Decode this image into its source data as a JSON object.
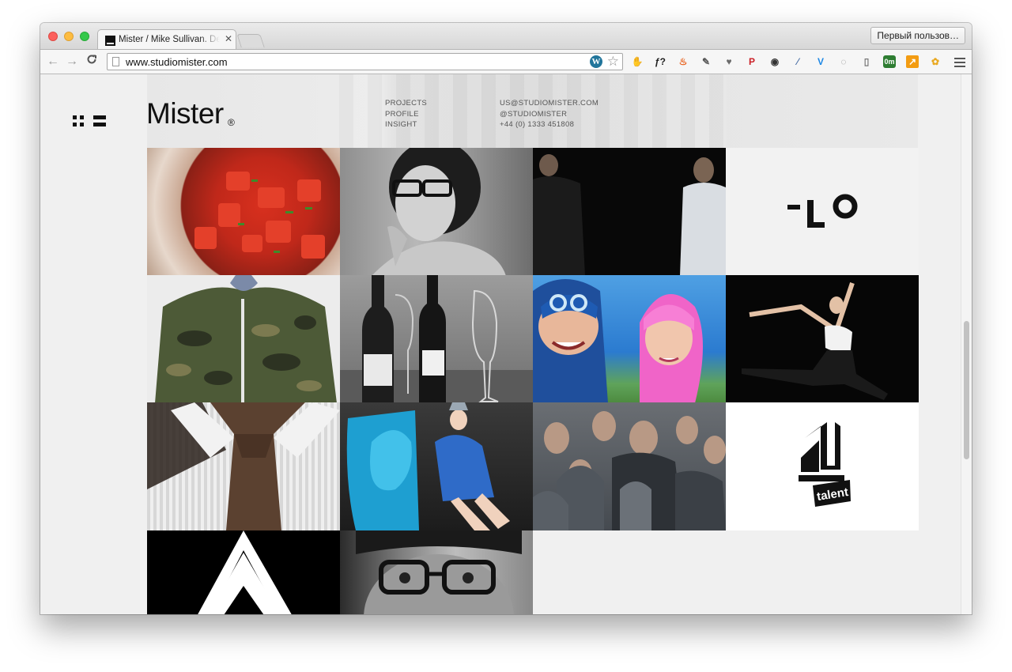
{
  "browser": {
    "tab_title": "Mister / Mike Sullivan. Design",
    "tab_close": "✕",
    "profile_button": "Первый пользов…",
    "url": "www.studiomister.com",
    "back": "←",
    "forward": "→",
    "reload": "C",
    "star": "☆",
    "wp_badge": "W",
    "extensions": [
      {
        "icon": "adblock-icon",
        "glyph": "✋",
        "color": "#d9201c"
      },
      {
        "icon": "function-icon",
        "glyph": "ƒ?",
        "color": "#222222"
      },
      {
        "icon": "fire-icon",
        "glyph": "♨",
        "color": "#e8601c"
      },
      {
        "icon": "evernote-icon",
        "glyph": "✎",
        "color": "#555555"
      },
      {
        "icon": "pocket-icon",
        "glyph": "♥",
        "color": "#6b6b6b"
      },
      {
        "icon": "pinterest-icon",
        "glyph": "P",
        "color": "#cb2027"
      },
      {
        "icon": "camera-icon",
        "glyph": "◉",
        "color": "#333333"
      },
      {
        "icon": "eyedropper-icon",
        "glyph": "⁄",
        "color": "#4a6fa5"
      },
      {
        "icon": "v-icon",
        "glyph": "V",
        "color": "#1e88e5"
      },
      {
        "icon": "spinner-icon",
        "glyph": "◌",
        "color": "#888888"
      },
      {
        "icon": "reader-icon",
        "glyph": "▯",
        "color": "#777777"
      },
      {
        "icon": "ext-om-icon",
        "glyph": "0m",
        "color": "#2e7d32"
      },
      {
        "icon": "chart-icon",
        "glyph": "↗",
        "color": "#f39c12"
      },
      {
        "icon": "flower-icon",
        "glyph": "✿",
        "color": "#e9a820"
      }
    ]
  },
  "site": {
    "logo": "Mister",
    "logo_mark": "®",
    "nav": [
      "PROJECTS",
      "PROFILE",
      "INSIGHT"
    ],
    "contact": {
      "email": "US@STUDIOMISTER.COM",
      "twitter": "@STUDIOMISTER",
      "phone": "+44 (0) 1333 451808"
    }
  },
  "tiles": [
    {
      "id": "salsa",
      "alt": "tomato salsa"
    },
    {
      "id": "glasses-woman",
      "alt": "woman with glasses"
    },
    {
      "id": "band",
      "alt": "two men in dark"
    },
    {
      "id": "lo-logo",
      "alt": "LO logo",
      "text": "LO"
    },
    {
      "id": "camo-jacket",
      "alt": "camouflage jacket"
    },
    {
      "id": "wine",
      "alt": "wine bottles"
    },
    {
      "id": "lazytown",
      "alt": "sportacus and stephanie"
    },
    {
      "id": "dancer",
      "alt": "dancer leaping"
    },
    {
      "id": "tie",
      "alt": "knitted tie"
    },
    {
      "id": "blue-fashion",
      "alt": "fashion blue paint"
    },
    {
      "id": "crowd",
      "alt": "crowd"
    },
    {
      "id": "talent-logo",
      "alt": "4 talent logo",
      "text": "talent"
    },
    {
      "id": "arrow-logo",
      "alt": "white arrow on black"
    },
    {
      "id": "portrait",
      "alt": "man with glasses portrait"
    }
  ]
}
